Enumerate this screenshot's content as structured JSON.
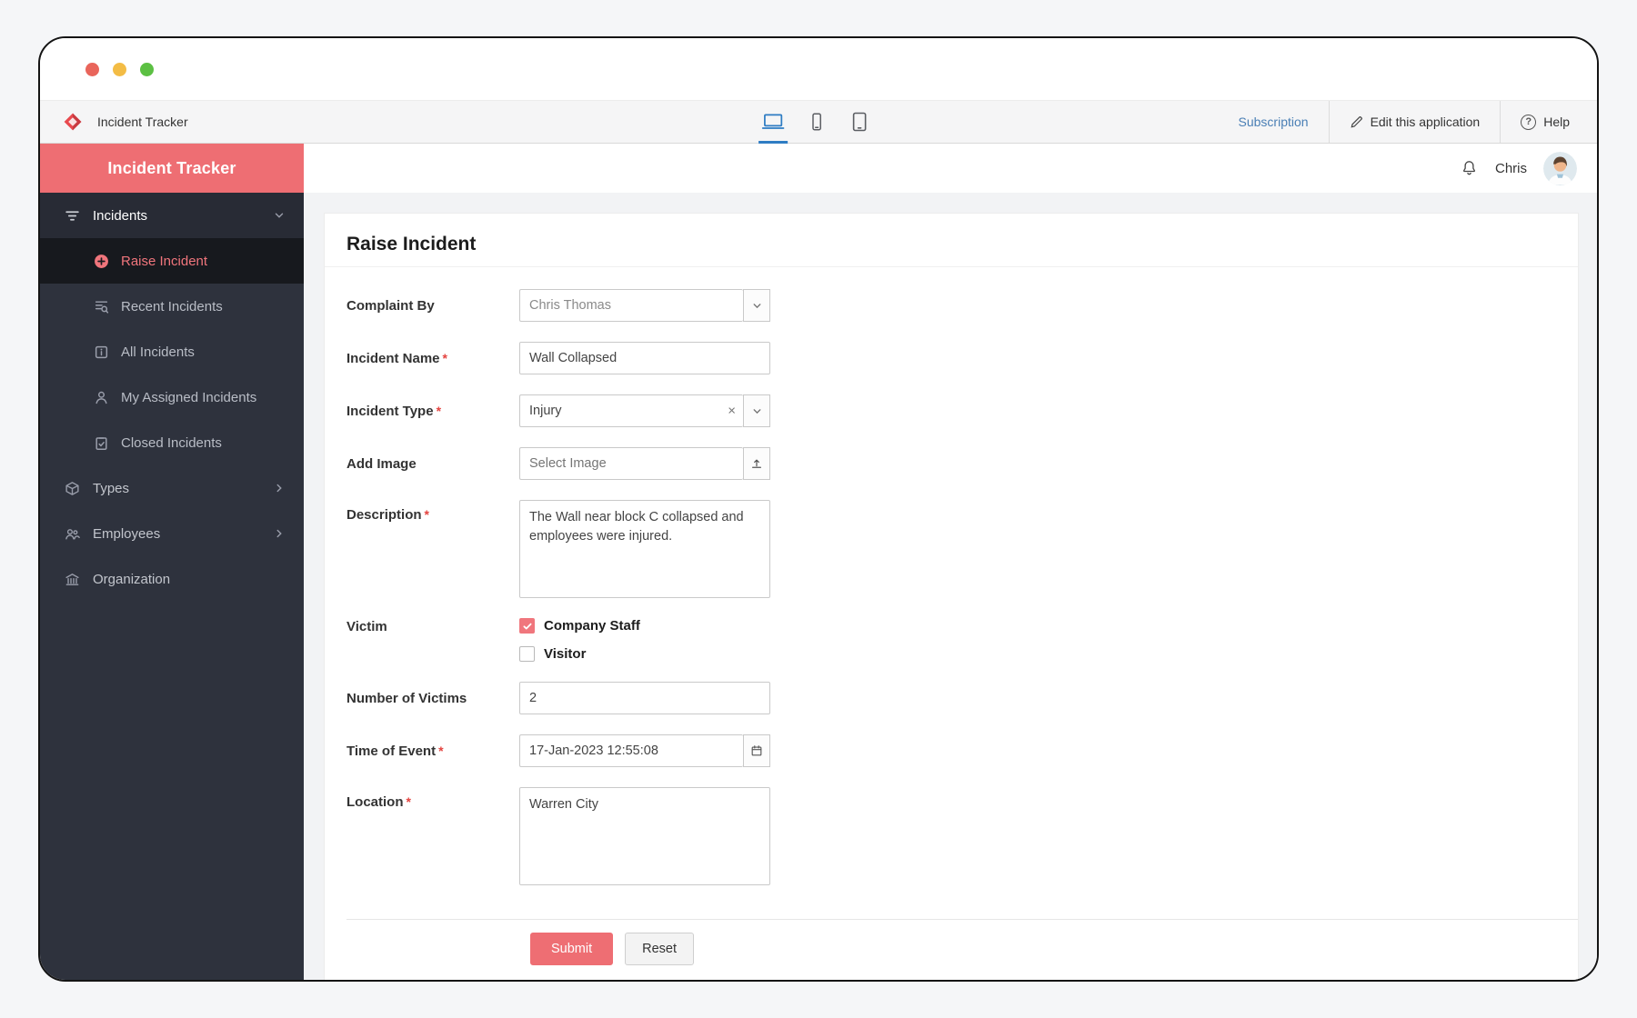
{
  "colors": {
    "accent": "#ee6e73",
    "sidebar_bg": "#2e323d",
    "active_item_bg": "#17191e",
    "active_item_text": "#f0757c",
    "link_blue": "#4a7fb5",
    "device_active_blue": "#2e7cc3",
    "required_red": "#e4433f"
  },
  "toolbar": {
    "app_name": "Incident Tracker",
    "subscription_label": "Subscription",
    "edit_label": "Edit this application",
    "help_label": "Help",
    "active_device": "laptop"
  },
  "sidebar": {
    "header": "Incident Tracker",
    "items": [
      {
        "label": "Incidents",
        "icon": "filter-icon",
        "state": "expanded"
      },
      {
        "label": "Raise Incident",
        "icon": "plus-circle-icon",
        "state": "active"
      },
      {
        "label": "Recent Incidents",
        "icon": "recent-incidents-icon"
      },
      {
        "label": "All Incidents",
        "icon": "info-square-icon"
      },
      {
        "label": "My Assigned Incidents",
        "icon": "person-icon"
      },
      {
        "label": "Closed Incidents",
        "icon": "clipboard-icon"
      },
      {
        "label": "Types",
        "icon": "cube-icon",
        "state": "collapsed"
      },
      {
        "label": "Employees",
        "icon": "people-icon",
        "state": "collapsed"
      },
      {
        "label": "Organization",
        "icon": "building-icon"
      }
    ]
  },
  "header": {
    "user_name": "Chris"
  },
  "form": {
    "title": "Raise Incident",
    "required_marker": "*",
    "fields": {
      "complaint_by": {
        "label": "Complaint By",
        "value": "Chris Thomas"
      },
      "incident_name": {
        "label": "Incident Name",
        "required": true,
        "value": "Wall Collapsed"
      },
      "incident_type": {
        "label": "Incident Type",
        "required": true,
        "value": "Injury"
      },
      "add_image": {
        "label": "Add Image",
        "placeholder": "Select Image"
      },
      "description": {
        "label": "Description",
        "required": true,
        "value": "The Wall near block C collapsed and employees were injured."
      },
      "victim": {
        "label": "Victim",
        "options": [
          {
            "label": "Company Staff",
            "checked": true
          },
          {
            "label": "Visitor",
            "checked": false
          }
        ]
      },
      "number_of_victims": {
        "label": "Number of Victims",
        "value": "2"
      },
      "time_of_event": {
        "label": "Time of Event",
        "required": true,
        "value": "17-Jan-2023 12:55:08"
      },
      "location": {
        "label": "Location",
        "required": true,
        "value": "Warren City"
      }
    },
    "buttons": {
      "submit": "Submit",
      "reset": "Reset"
    }
  }
}
